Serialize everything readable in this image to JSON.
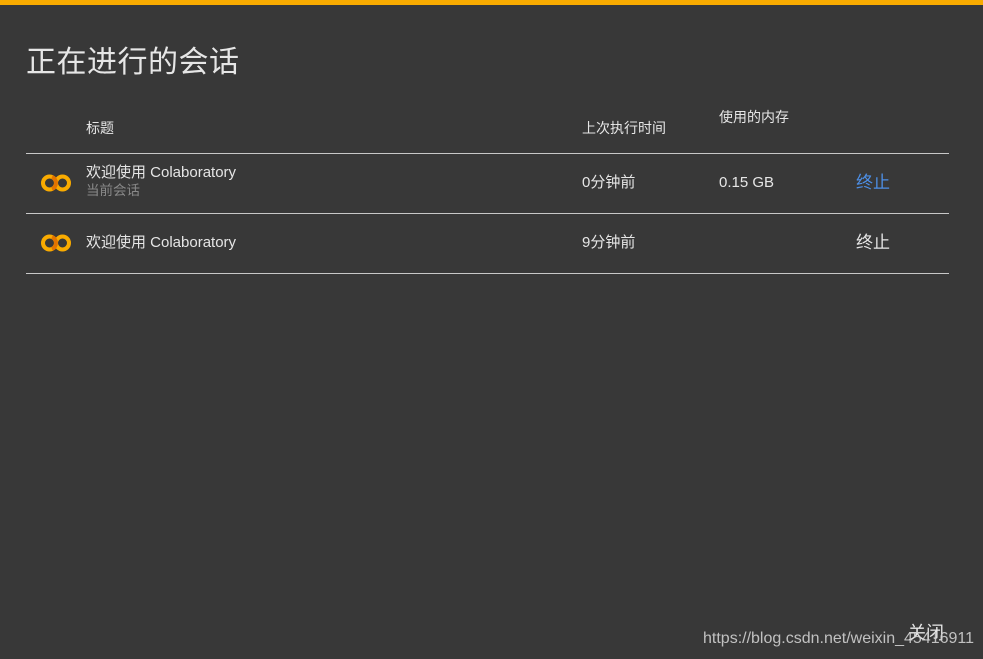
{
  "accent_color": "#f9ab00",
  "dialog": {
    "title": "正在进行的会话",
    "close_label": "关闭"
  },
  "table": {
    "headers": {
      "title": "标题",
      "last_exec": "上次执行时间",
      "memory": "使用的内存"
    },
    "rows": [
      {
        "icon": "colab-logo-icon",
        "title": "欢迎使用 Colaboratory",
        "subtitle": "当前会话",
        "last_exec": "0分钟前",
        "memory": "0.15 GB",
        "action": "终止"
      },
      {
        "icon": "colab-logo-icon",
        "title": "欢迎使用 Colaboratory",
        "last_exec": "9分钟前",
        "action": "终止"
      }
    ]
  },
  "watermark": "https://blog.csdn.net/weixin_45416911"
}
